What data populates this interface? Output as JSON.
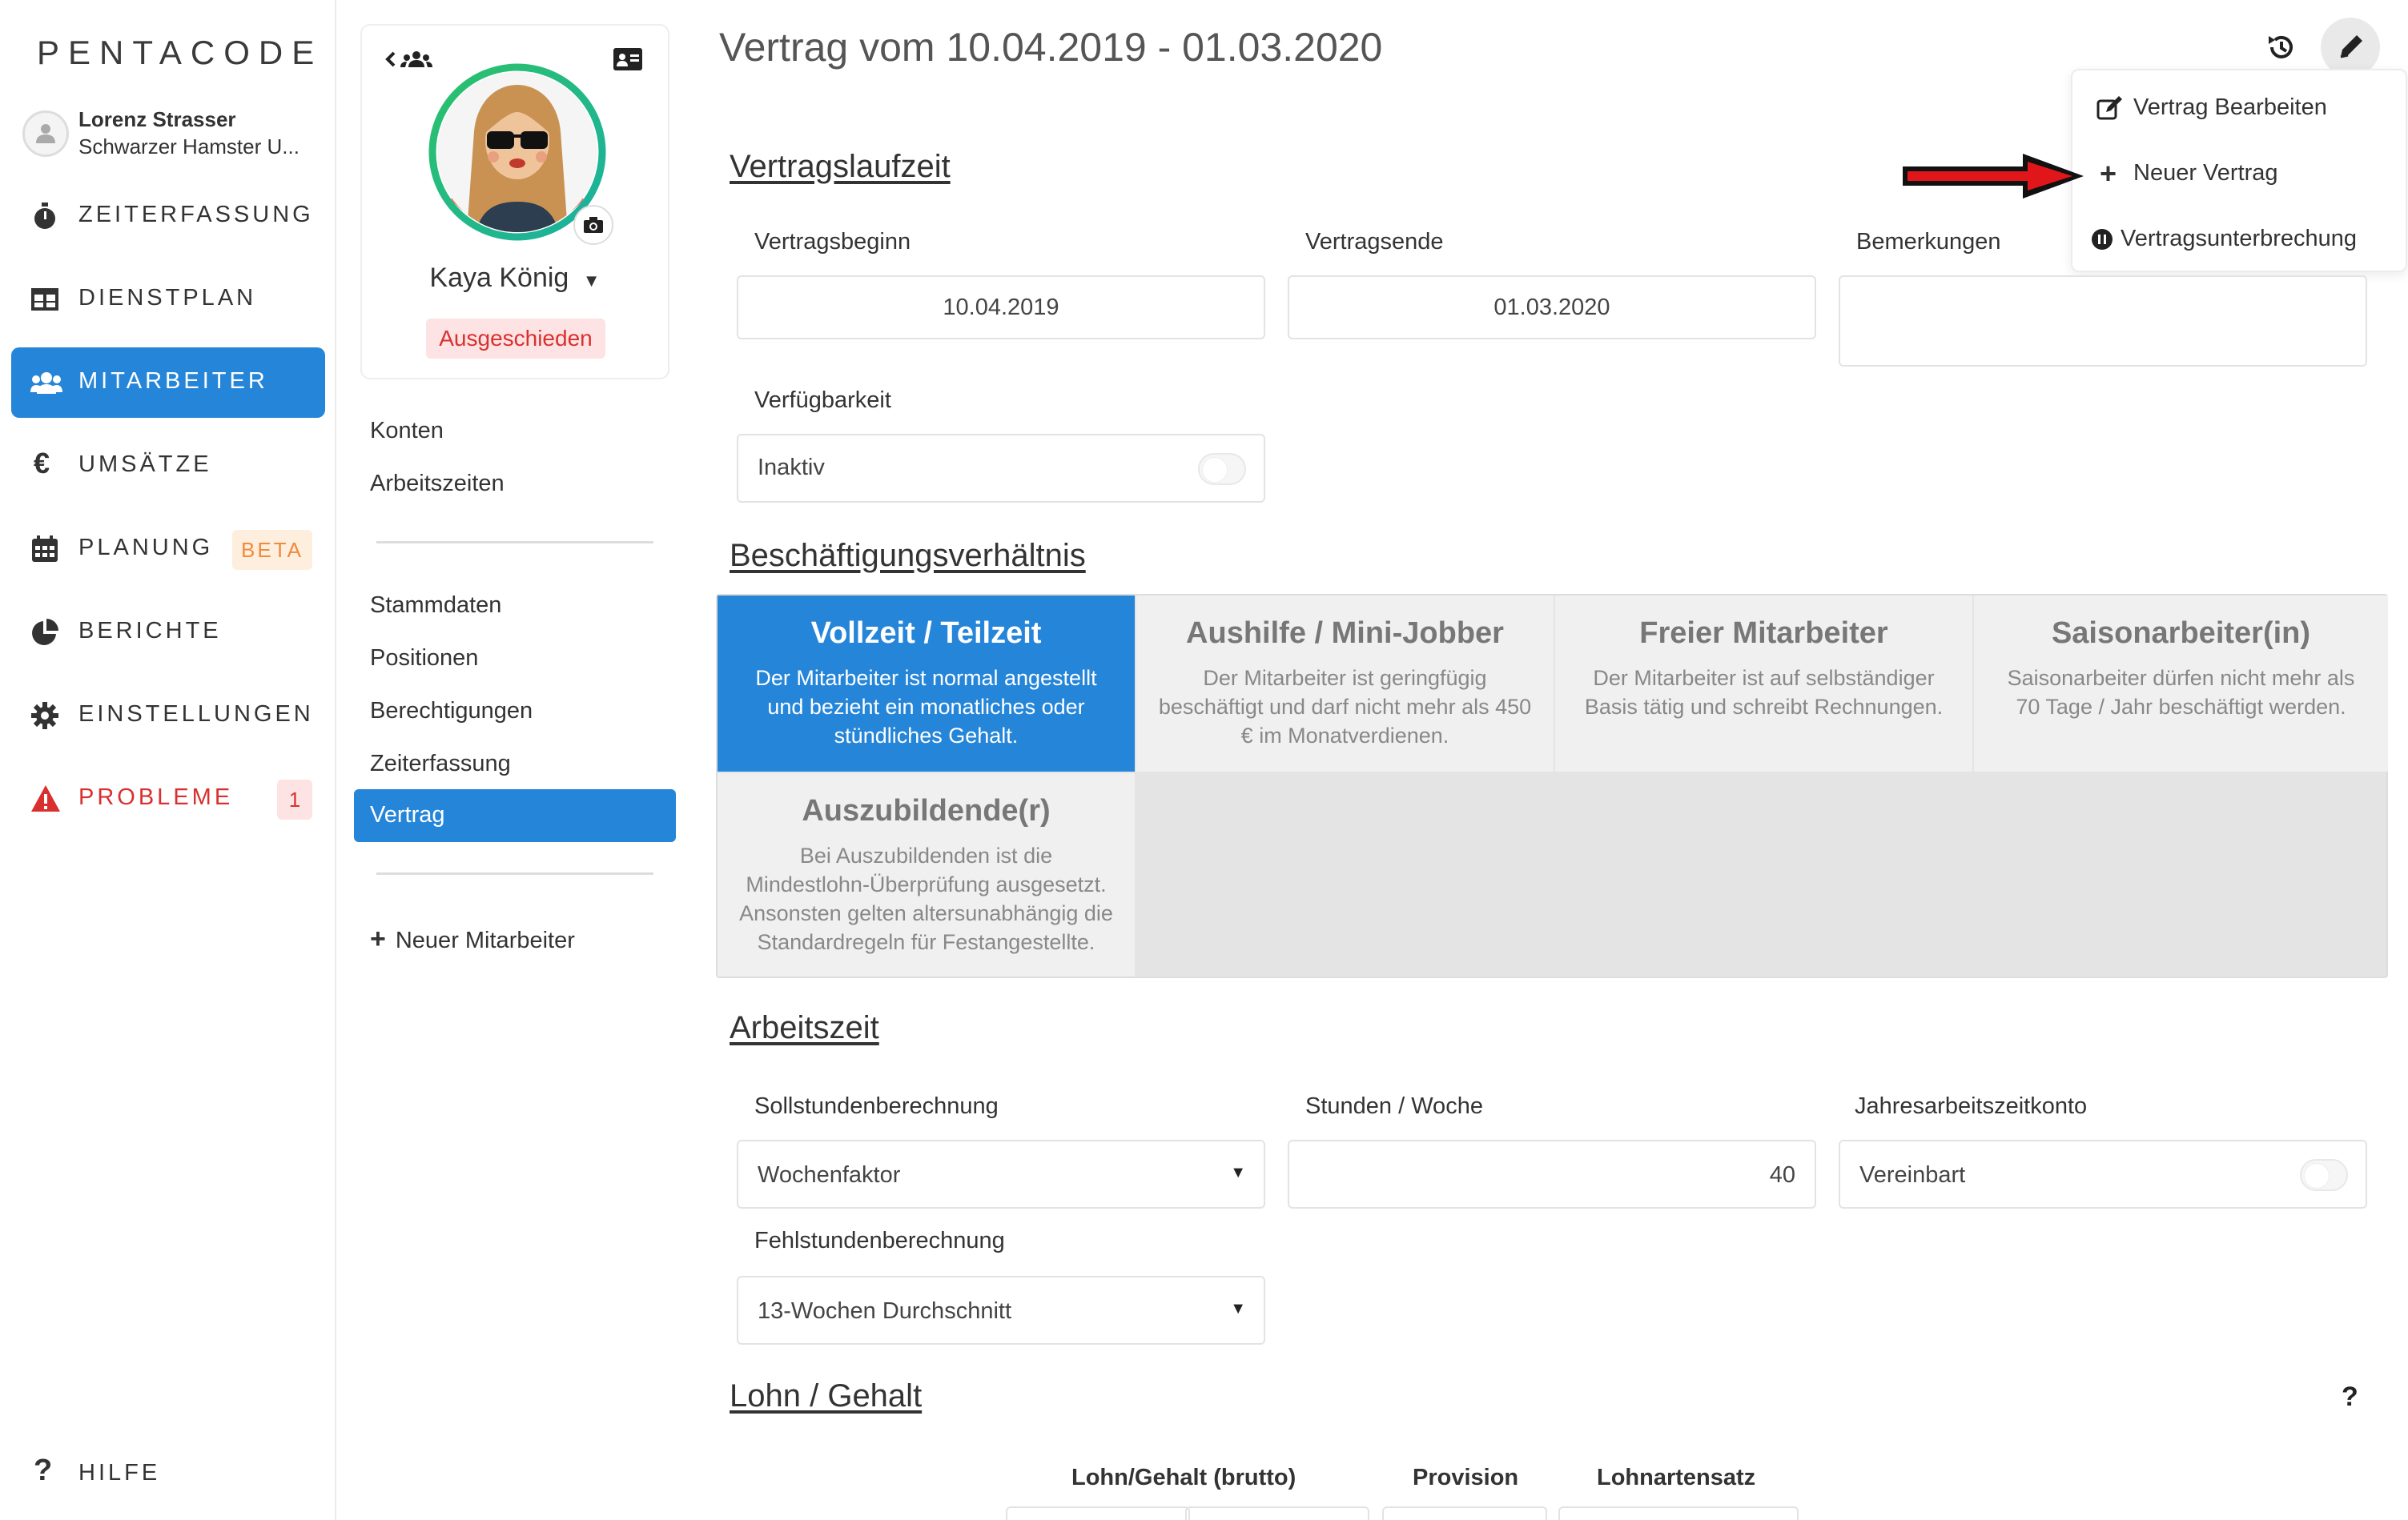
{
  "app": {
    "logo": "PENTACODE"
  },
  "user": {
    "name": "Lorenz Strasser",
    "company": "Schwarzer Hamster U..."
  },
  "nav": [
    {
      "label": "ZEITERFASSUNG",
      "icon": "stopwatch-icon"
    },
    {
      "label": "DIENSTPLAN",
      "icon": "table-icon"
    },
    {
      "label": "MITARBEITER",
      "icon": "users-icon",
      "active": true
    },
    {
      "label": "UMSÄTZE",
      "icon": "euro-icon"
    },
    {
      "label": "PLANUNG",
      "icon": "calendar-icon",
      "badge": "BETA"
    },
    {
      "label": "BERICHTE",
      "icon": "pie-chart-icon"
    },
    {
      "label": "EINSTELLUNGEN",
      "icon": "gear-icon"
    },
    {
      "label": "PROBLEME",
      "icon": "warning-icon",
      "badge": "1"
    }
  ],
  "help": {
    "label": "HILFE"
  },
  "employee": {
    "name": "Kaya König",
    "status": "Ausgeschieden"
  },
  "submenu": {
    "group1": [
      "Konten",
      "Arbeitszeiten"
    ],
    "group2": [
      "Stammdaten",
      "Positionen",
      "Berechtigungen",
      "Zeiterfassung",
      "Vertrag"
    ],
    "active": "Vertrag",
    "new_employee": "Neuer Mitarbeiter"
  },
  "contract": {
    "title": "Vertrag vom 10.04.2019 - 01.03.2020",
    "sections": {
      "laufzeit": "Vertragslaufzeit",
      "beschaeftigung": "Beschäftigungsverhältnis",
      "arbeitszeit": "Arbeitszeit",
      "lohn": "Lohn / Gehalt"
    },
    "start_label": "Vertragsbeginn",
    "start_value": "10.04.2019",
    "end_label": "Vertragsende",
    "end_value": "01.03.2020",
    "notes_label": "Bemerkungen",
    "notes_value": "",
    "availability_label": "Verfügbarkeit",
    "availability_value": "Inaktiv",
    "availability_on": false
  },
  "employment_types": [
    {
      "title": "Vollzeit / Teilzeit",
      "desc": "Der Mitarbeiter ist normal angestellt und bezieht ein monatliches oder stündliches Gehalt.",
      "selected": true
    },
    {
      "title": "Aushilfe / Mini-Jobber",
      "desc": "Der Mitarbeiter ist geringfügig beschäftigt und darf nicht mehr als 450 € im Monatverdienen.",
      "selected": false
    },
    {
      "title": "Freier Mitarbeiter",
      "desc": "Der Mitarbeiter ist auf selbständiger Basis tätig und schreibt Rechnungen.",
      "selected": false
    },
    {
      "title": "Saisonarbeiter(in)",
      "desc": "Saisonarbeiter dürfen nicht mehr als 70 Tage / Jahr beschäftigt werden.",
      "selected": false
    },
    {
      "title": "Auszubildende(r)",
      "desc": "Bei Auszubildenden ist die Mindestlohn-Überprüfung ausgesetzt. Ansonsten gelten altersunabhängig die Standardregeln für Festangestellte.",
      "selected": false
    }
  ],
  "worktime": {
    "soll_label": "Sollstundenberechnung",
    "soll_value": "Wochenfaktor",
    "hours_label": "Stunden / Woche",
    "hours_value": "40",
    "annual_label": "Jahresarbeitszeitkonto",
    "annual_value": "Vereinbart",
    "annual_on": false,
    "absence_label": "Fehlstundenberechnung",
    "absence_value": "13-Wochen Durchschnitt"
  },
  "pay": {
    "help": "?",
    "columns": [
      "Lohn/Gehalt (brutto)",
      "Provision",
      "Lohnartensatz"
    ]
  },
  "dropdown": {
    "items": [
      {
        "label": "Vertrag Bearbeiten",
        "icon": "edit-icon"
      },
      {
        "label": "Neuer Vertrag",
        "icon": "plus-icon"
      },
      {
        "label": "Vertragsunterbrechung",
        "icon": "pause-icon"
      }
    ]
  },
  "colors": {
    "accent": "#2585d8",
    "danger": "#d9302f",
    "beta": "#f08a3c",
    "annotation_arrow": "#e0161b"
  }
}
